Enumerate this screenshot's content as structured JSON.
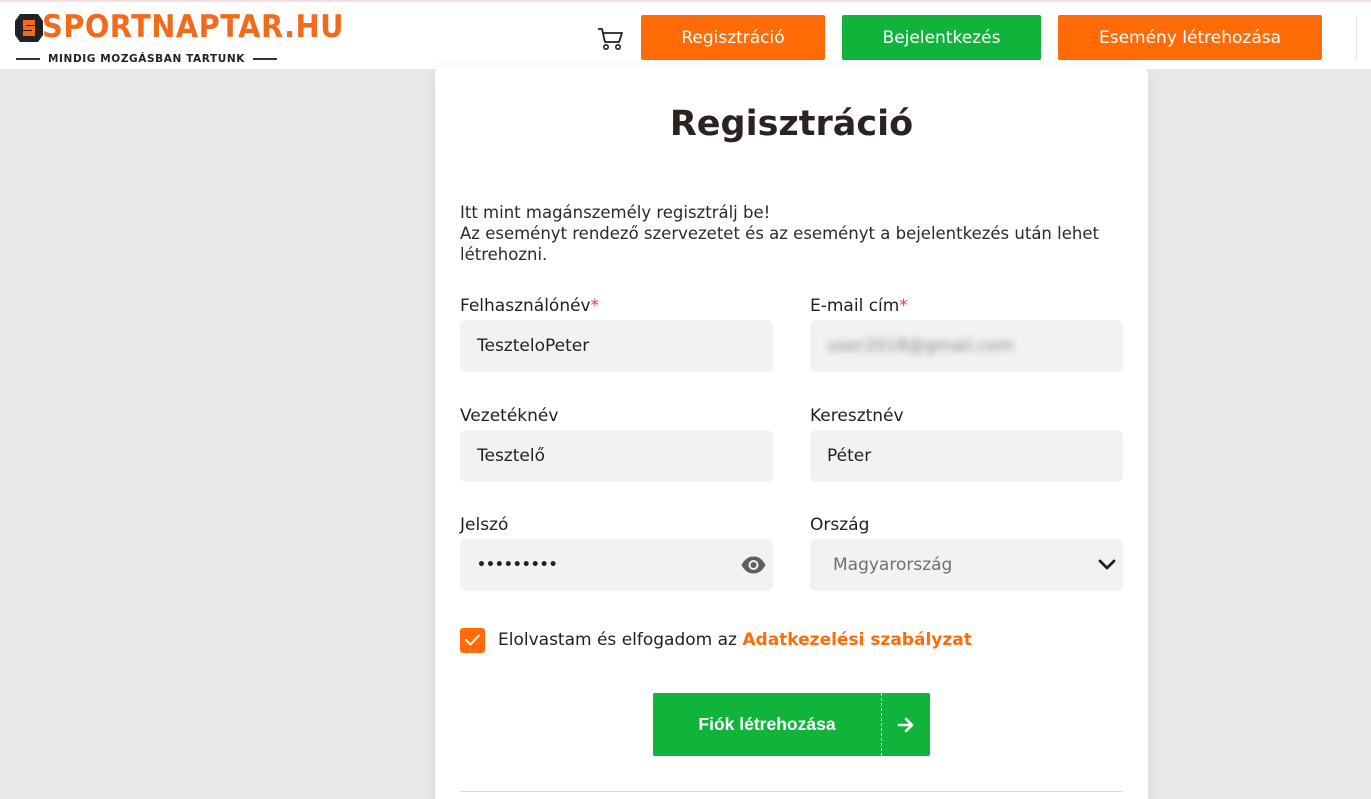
{
  "header": {
    "logo": {
      "name_part1": "SPORT",
      "name_part2": "NAPTAR.HU",
      "tagline": "MINDIG MOZGÁSBAN TARTUNK",
      "icon": "sportnaptar-logo-mark"
    },
    "cart_icon": "shopping-cart-icon",
    "buttons": {
      "register": "Regisztráció",
      "login": "Bejelentkezés",
      "create_event": "Esemény létrehozása"
    }
  },
  "form": {
    "title": "Regisztráció",
    "intro_line1": "Itt mint magánszemély regisztrálj be!",
    "intro_line2": "Az eseményt rendező szervezetet és az eseményt a bejelentkezés után lehet létrehozni.",
    "required_marker": "*",
    "username": {
      "label": "Felhasználónév",
      "value": "TeszteloPeter"
    },
    "email": {
      "label": "E-mail cím",
      "value": "user2018@gmail.com",
      "blurred": true
    },
    "last_name": {
      "label": "Vezetéknév",
      "value": "Tesztelő"
    },
    "first_name": {
      "label": "Keresztnév",
      "value": "Péter"
    },
    "password": {
      "label": "Jelszó",
      "value": "•••••••••",
      "toggle_icon": "eye-icon"
    },
    "country": {
      "label": "Ország",
      "value": "Magyarország",
      "dropdown_icon": "chevron-down-icon"
    },
    "consent": {
      "checked": true,
      "text": "Elolvastam és elfogadom az",
      "link": "Adatkezelési szabályzat"
    },
    "submit": {
      "label": "Fiók létrehozása",
      "icon": "arrow-right-icon"
    }
  },
  "colors": {
    "brand_orange": "#ff6b06",
    "brand_green": "#11b43b",
    "page_bg": "#e9e9e9",
    "input_bg": "#f2f2f2"
  }
}
